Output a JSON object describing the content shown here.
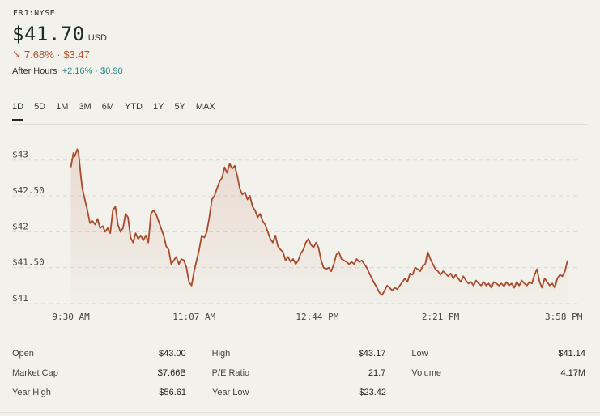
{
  "quote": {
    "ticker": "ERJ:NYSE",
    "price": "$41.70",
    "currency": "USD",
    "change": "7.68% · $3.47",
    "after_hours_label": "After Hours",
    "after_hours_change": "+2.16% · $0.90"
  },
  "tabs": [
    {
      "label": "1D",
      "active": true
    },
    {
      "label": "5D"
    },
    {
      "label": "1M"
    },
    {
      "label": "3M"
    },
    {
      "label": "6M"
    },
    {
      "label": "YTD"
    },
    {
      "label": "1Y"
    },
    {
      "label": "5Y"
    },
    {
      "label": "MAX"
    }
  ],
  "colors": {
    "line": "#a84a2c",
    "change_down": "#b5502a",
    "after_hours_up": "#2b8a8a",
    "grid": "#d8d7d0"
  },
  "chart_data": {
    "type": "line",
    "y_tick_labels": [
      "$43",
      "$42.50",
      "$42",
      "$41.50",
      "$41"
    ],
    "y_ticks": [
      43,
      42.5,
      42,
      41.5,
      41
    ],
    "ylim": [
      41,
      43.2
    ],
    "x_tick_labels": [
      "9:30 AM",
      "11:07 AM",
      "12:44 PM",
      "2:21 PM",
      "3:58 PM"
    ],
    "x_ticks": [
      0,
      97,
      194,
      291,
      388
    ],
    "xlim": [
      -8,
      400
    ],
    "grid": true,
    "series": [
      {
        "values": [
          [
            0,
            42.9
          ],
          [
            2,
            43.1
          ],
          [
            3,
            43.05
          ],
          [
            5,
            43.15
          ],
          [
            6,
            43.1
          ],
          [
            8,
            42.75
          ],
          [
            9,
            42.6
          ],
          [
            11,
            42.45
          ],
          [
            13,
            42.3
          ],
          [
            15,
            42.12
          ],
          [
            17,
            42.15
          ],
          [
            19,
            42.1
          ],
          [
            21,
            42.18
          ],
          [
            23,
            42.05
          ],
          [
            25,
            42.08
          ],
          [
            27,
            42.0
          ],
          [
            29,
            42.05
          ],
          [
            31,
            41.98
          ],
          [
            33,
            42.3
          ],
          [
            35,
            42.35
          ],
          [
            37,
            42.1
          ],
          [
            39,
            42.0
          ],
          [
            41,
            42.05
          ],
          [
            43,
            42.25
          ],
          [
            45,
            42.2
          ],
          [
            47,
            41.92
          ],
          [
            49,
            41.85
          ],
          [
            51,
            41.98
          ],
          [
            53,
            41.9
          ],
          [
            55,
            41.95
          ],
          [
            57,
            41.88
          ],
          [
            59,
            41.95
          ],
          [
            61,
            41.85
          ],
          [
            63,
            42.25
          ],
          [
            65,
            42.3
          ],
          [
            67,
            42.25
          ],
          [
            69,
            42.15
          ],
          [
            71,
            42.05
          ],
          [
            73,
            41.95
          ],
          [
            75,
            41.8
          ],
          [
            77,
            41.75
          ],
          [
            79,
            41.55
          ],
          [
            81,
            41.6
          ],
          [
            83,
            41.65
          ],
          [
            85,
            41.55
          ],
          [
            87,
            41.62
          ],
          [
            89,
            41.6
          ],
          [
            91,
            41.5
          ],
          [
            93,
            41.3
          ],
          [
            95,
            41.25
          ],
          [
            97,
            41.45
          ],
          [
            99,
            41.6
          ],
          [
            101,
            41.75
          ],
          [
            103,
            41.95
          ],
          [
            105,
            41.92
          ],
          [
            107,
            42.0
          ],
          [
            109,
            42.2
          ],
          [
            111,
            42.45
          ],
          [
            113,
            42.5
          ],
          [
            115,
            42.6
          ],
          [
            117,
            42.7
          ],
          [
            119,
            42.75
          ],
          [
            121,
            42.9
          ],
          [
            123,
            42.82
          ],
          [
            125,
            42.95
          ],
          [
            127,
            42.88
          ],
          [
            129,
            42.92
          ],
          [
            131,
            42.78
          ],
          [
            133,
            42.6
          ],
          [
            135,
            42.52
          ],
          [
            137,
            42.55
          ],
          [
            139,
            42.45
          ],
          [
            141,
            42.5
          ],
          [
            143,
            42.35
          ],
          [
            145,
            42.3
          ],
          [
            147,
            42.2
          ],
          [
            149,
            42.25
          ],
          [
            151,
            42.15
          ],
          [
            153,
            42.1
          ],
          [
            155,
            42.0
          ],
          [
            157,
            41.9
          ],
          [
            159,
            41.85
          ],
          [
            161,
            41.95
          ],
          [
            163,
            41.8
          ],
          [
            165,
            41.75
          ],
          [
            167,
            41.72
          ],
          [
            169,
            41.6
          ],
          [
            171,
            41.65
          ],
          [
            173,
            41.58
          ],
          [
            175,
            41.62
          ],
          [
            177,
            41.55
          ],
          [
            179,
            41.6
          ],
          [
            181,
            41.7
          ],
          [
            183,
            41.75
          ],
          [
            185,
            41.85
          ],
          [
            187,
            41.9
          ],
          [
            189,
            41.82
          ],
          [
            191,
            41.78
          ],
          [
            193,
            41.85
          ],
          [
            195,
            41.78
          ],
          [
            197,
            41.6
          ],
          [
            199,
            41.5
          ],
          [
            201,
            41.48
          ],
          [
            203,
            41.5
          ],
          [
            205,
            41.45
          ],
          [
            207,
            41.55
          ],
          [
            209,
            41.68
          ],
          [
            211,
            41.72
          ],
          [
            213,
            41.62
          ],
          [
            215,
            41.6
          ],
          [
            217,
            41.58
          ],
          [
            219,
            41.55
          ],
          [
            221,
            41.58
          ],
          [
            223,
            41.55
          ],
          [
            225,
            41.62
          ],
          [
            227,
            41.58
          ],
          [
            229,
            41.6
          ],
          [
            231,
            41.55
          ],
          [
            233,
            41.5
          ],
          [
            235,
            41.42
          ],
          [
            237,
            41.35
          ],
          [
            239,
            41.28
          ],
          [
            241,
            41.22
          ],
          [
            243,
            41.15
          ],
          [
            245,
            41.12
          ],
          [
            247,
            41.18
          ],
          [
            249,
            41.25
          ],
          [
            251,
            41.22
          ],
          [
            253,
            41.18
          ],
          [
            255,
            41.22
          ],
          [
            257,
            41.2
          ],
          [
            259,
            41.25
          ],
          [
            261,
            41.3
          ],
          [
            263,
            41.35
          ],
          [
            265,
            41.3
          ],
          [
            267,
            41.42
          ],
          [
            269,
            41.4
          ],
          [
            271,
            41.5
          ],
          [
            273,
            41.48
          ],
          [
            275,
            41.45
          ],
          [
            277,
            41.52
          ],
          [
            279,
            41.55
          ],
          [
            281,
            41.72
          ],
          [
            283,
            41.62
          ],
          [
            285,
            41.55
          ],
          [
            287,
            41.48
          ],
          [
            289,
            41.45
          ],
          [
            291,
            41.4
          ],
          [
            293,
            41.45
          ],
          [
            295,
            41.42
          ],
          [
            297,
            41.38
          ],
          [
            299,
            41.42
          ],
          [
            301,
            41.35
          ],
          [
            303,
            41.4
          ],
          [
            305,
            41.35
          ],
          [
            307,
            41.3
          ],
          [
            309,
            41.38
          ],
          [
            311,
            41.32
          ],
          [
            313,
            41.28
          ],
          [
            315,
            41.3
          ],
          [
            317,
            41.25
          ],
          [
            319,
            41.32
          ],
          [
            321,
            41.28
          ],
          [
            323,
            41.25
          ],
          [
            325,
            41.3
          ],
          [
            327,
            41.25
          ],
          [
            329,
            41.28
          ],
          [
            331,
            41.22
          ],
          [
            333,
            41.3
          ],
          [
            335,
            41.28
          ],
          [
            337,
            41.25
          ],
          [
            339,
            41.28
          ],
          [
            341,
            41.24
          ],
          [
            343,
            41.3
          ],
          [
            345,
            41.25
          ],
          [
            347,
            41.28
          ],
          [
            349,
            41.22
          ],
          [
            351,
            41.3
          ],
          [
            353,
            41.25
          ],
          [
            355,
            41.32
          ],
          [
            357,
            41.28
          ],
          [
            359,
            41.25
          ],
          [
            361,
            41.3
          ],
          [
            363,
            41.28
          ],
          [
            365,
            41.4
          ],
          [
            367,
            41.48
          ],
          [
            369,
            41.3
          ],
          [
            371,
            41.22
          ],
          [
            373,
            41.35
          ],
          [
            375,
            41.3
          ],
          [
            377,
            41.25
          ],
          [
            379,
            41.28
          ],
          [
            381,
            41.22
          ],
          [
            383,
            41.35
          ],
          [
            385,
            41.4
          ],
          [
            387,
            41.38
          ],
          [
            389,
            41.45
          ],
          [
            391,
            41.6
          ]
        ]
      }
    ]
  },
  "stats": [
    [
      {
        "label": "Open",
        "value": "$43.00"
      },
      {
        "label": "High",
        "value": "$43.17"
      },
      {
        "label": "Low",
        "value": "$41.14"
      }
    ],
    [
      {
        "label": "Market Cap",
        "value": "$7.66B"
      },
      {
        "label": "P/E Ratio",
        "value": "21.7"
      },
      {
        "label": "Volume",
        "value": "4.17M"
      }
    ],
    [
      {
        "label": "Year High",
        "value": "$56.61"
      },
      {
        "label": "Year Low",
        "value": "$23.42"
      }
    ]
  ]
}
